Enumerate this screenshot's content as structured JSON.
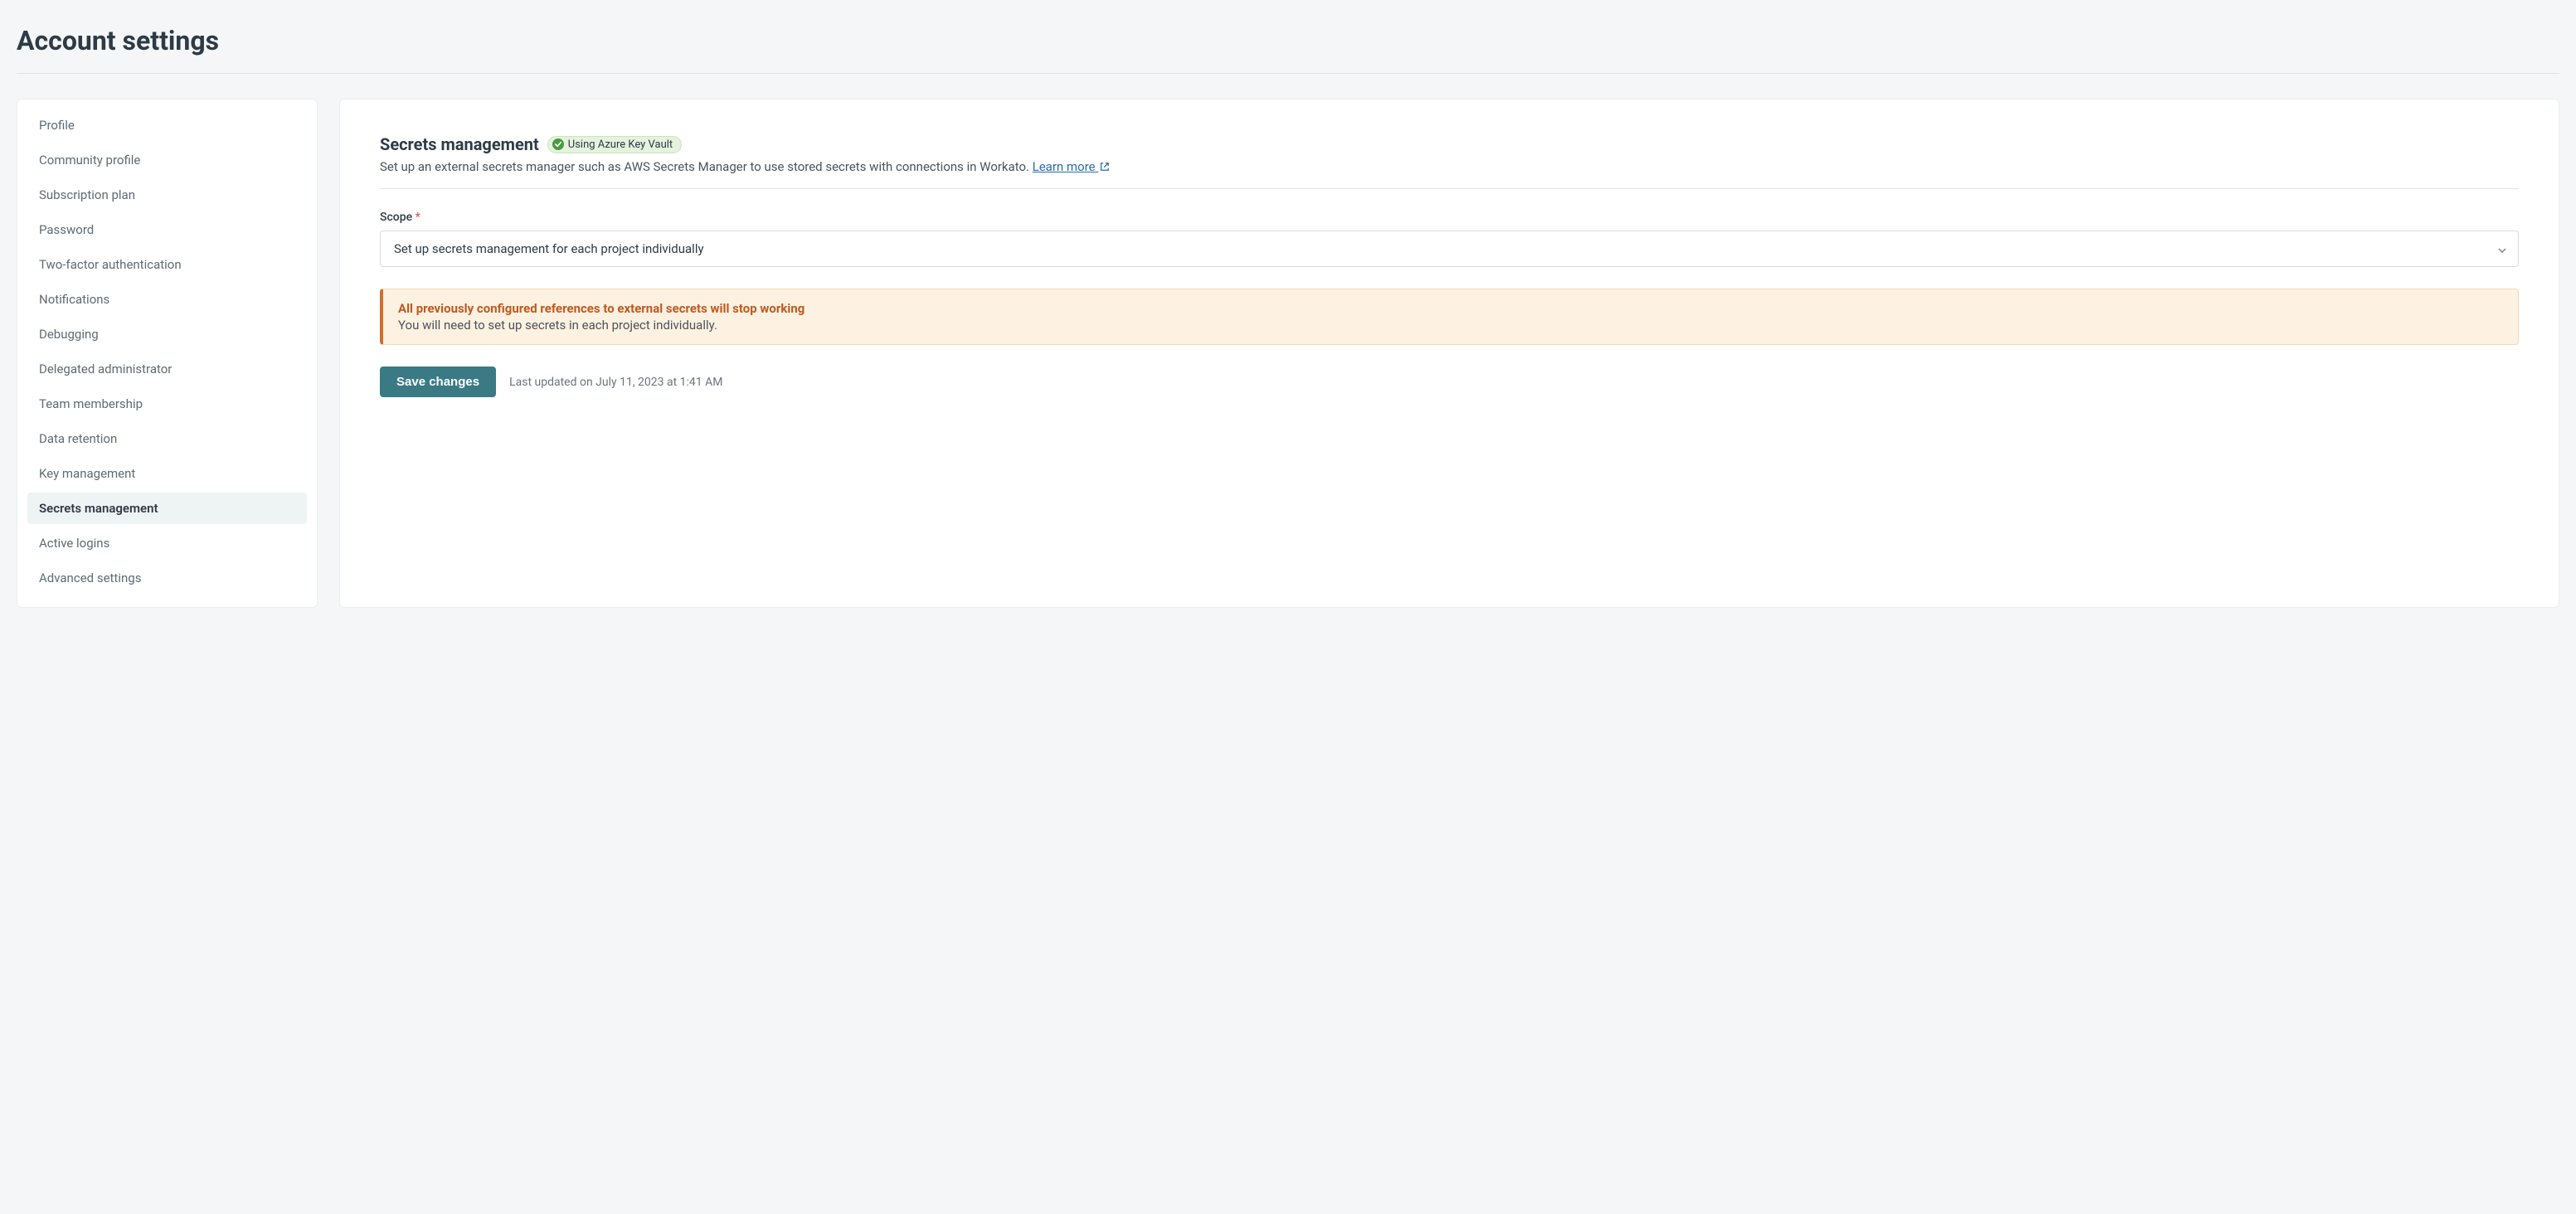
{
  "page": {
    "title": "Account settings"
  },
  "sidebar": {
    "items": [
      {
        "label": "Profile",
        "active": false
      },
      {
        "label": "Community profile",
        "active": false
      },
      {
        "label": "Subscription plan",
        "active": false
      },
      {
        "label": "Password",
        "active": false
      },
      {
        "label": "Two-factor authentication",
        "active": false
      },
      {
        "label": "Notifications",
        "active": false
      },
      {
        "label": "Debugging",
        "active": false
      },
      {
        "label": "Delegated administrator",
        "active": false
      },
      {
        "label": "Team membership",
        "active": false
      },
      {
        "label": "Data retention",
        "active": false
      },
      {
        "label": "Key management",
        "active": false
      },
      {
        "label": "Secrets management",
        "active": true
      },
      {
        "label": "Active logins",
        "active": false
      },
      {
        "label": "Advanced settings",
        "active": false
      }
    ]
  },
  "main": {
    "section_title": "Secrets management",
    "badge_label": "Using Azure Key Vault",
    "description_prefix": "Set up an external secrets manager such as AWS Secrets Manager to use stored secrets with connections in Workato. ",
    "learn_more_label": "Learn more",
    "scope_label": "Scope",
    "required_mark": "*",
    "scope_value": "Set up secrets management for each project individually",
    "warning_title": "All previously configured references to external secrets will stop working",
    "warning_body": "You will need to set up secrets in each project individually.",
    "save_label": "Save changes",
    "last_updated": "Last updated on July 11, 2023 at 1:41 AM"
  }
}
